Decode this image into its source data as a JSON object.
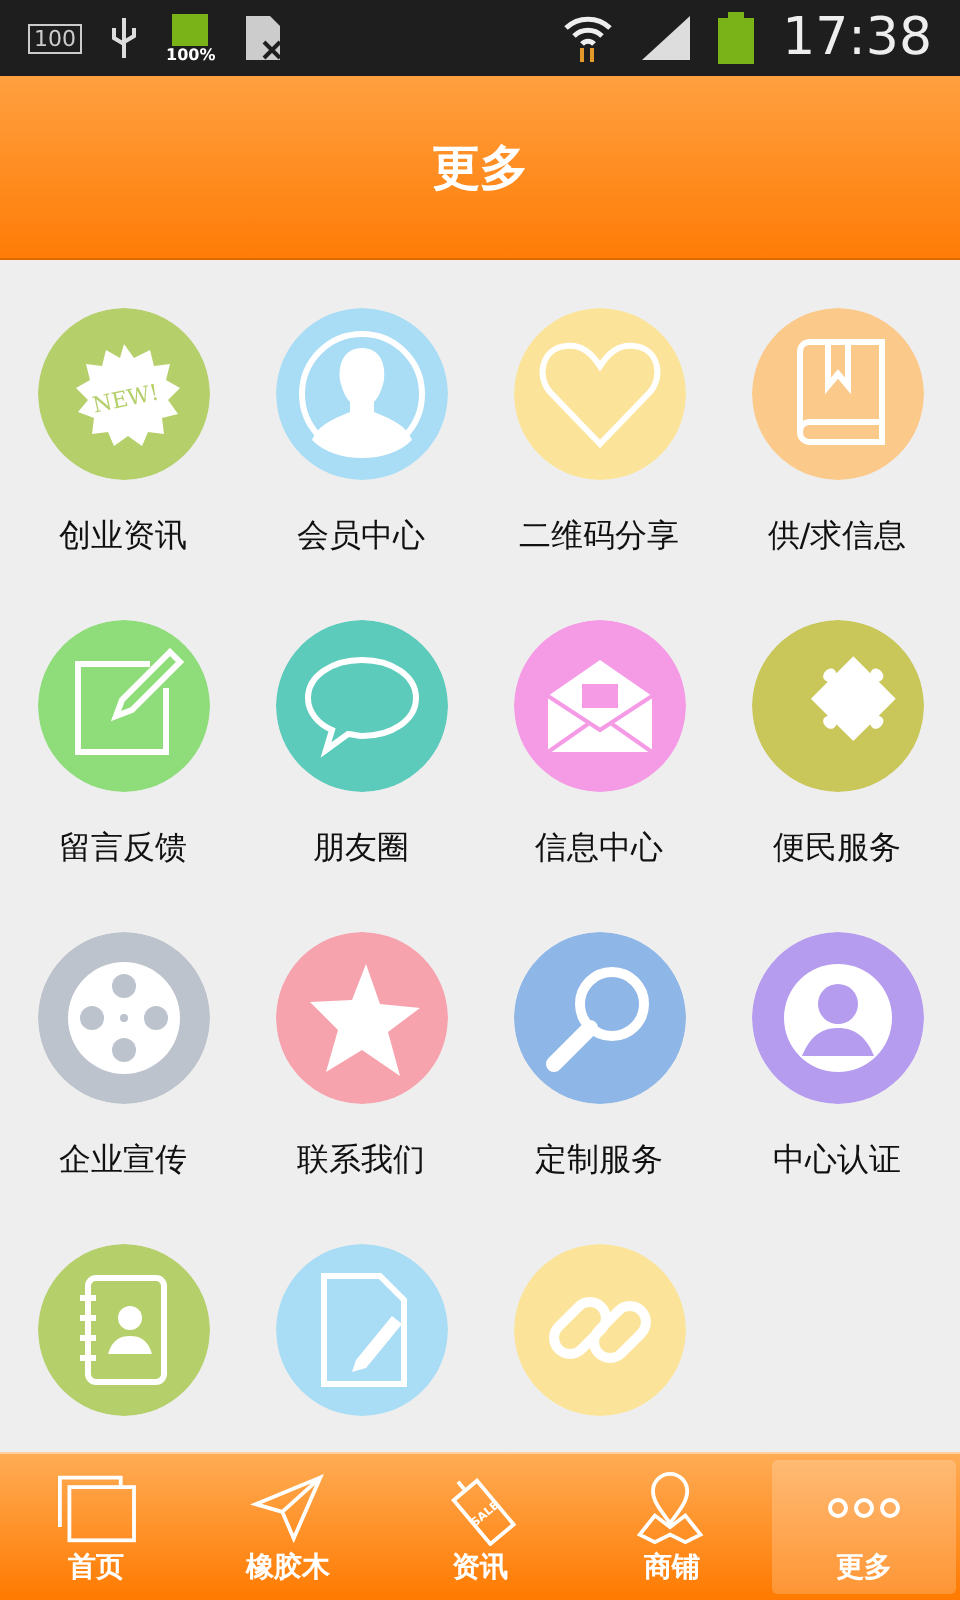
{
  "status_bar": {
    "storage_badge": "100",
    "battery_percent": "100%",
    "time": "17:38"
  },
  "header": {
    "title": "更多"
  },
  "grid": [
    {
      "label": "创业资讯",
      "kind": "new",
      "color": "#b5cf6a",
      "icon_text": "NEW!"
    },
    {
      "label": "会员中心",
      "kind": "person",
      "color": "#a9dcf5"
    },
    {
      "label": "二维码分享",
      "kind": "heart",
      "color": "#fbe49a"
    },
    {
      "label": "供/求信息",
      "kind": "book",
      "color": "#fbc98a"
    },
    {
      "label": "留言反馈",
      "kind": "note",
      "color": "#8fdc7a"
    },
    {
      "label": "朋友圈",
      "kind": "chat",
      "color": "#5ccbbb"
    },
    {
      "label": "信息中心",
      "kind": "mail",
      "color": "#f59be6"
    },
    {
      "label": "便民服务",
      "kind": "puzzle",
      "color": "#c9c65a"
    },
    {
      "label": "企业宣传",
      "kind": "film",
      "color": "#bcc3cc"
    },
    {
      "label": "联系我们",
      "kind": "star",
      "color": "#f7a3ae"
    },
    {
      "label": "定制服务",
      "kind": "search",
      "color": "#8eb6e6"
    },
    {
      "label": "中心认证",
      "kind": "user",
      "color": "#b59cef"
    },
    {
      "kind": "contacts",
      "color": "#b5cf6a"
    },
    {
      "kind": "document",
      "color": "#a9dcf5"
    },
    {
      "kind": "link",
      "color": "#fbe49a"
    }
  ],
  "bottom_nav": [
    {
      "label": "首页",
      "kind": "pages",
      "selected": false
    },
    {
      "label": "橡胶木",
      "kind": "plane",
      "selected": false
    },
    {
      "label": "资讯",
      "kind": "tag",
      "selected": false,
      "icon_text": "SALE"
    },
    {
      "label": "商铺",
      "kind": "map",
      "selected": false
    },
    {
      "label": "更多",
      "kind": "dots",
      "selected": true
    }
  ]
}
